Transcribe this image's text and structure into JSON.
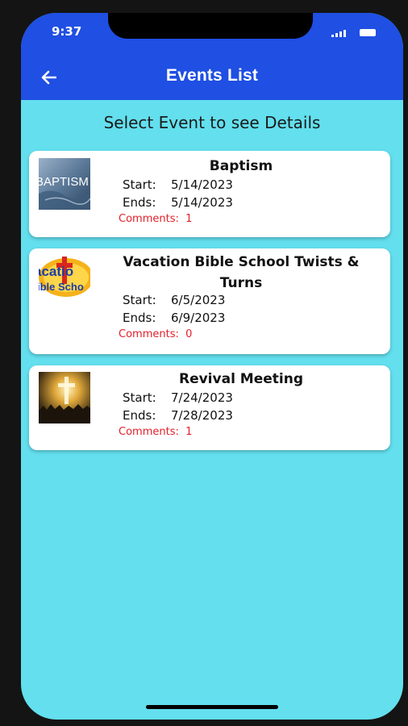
{
  "status_bar": {
    "time": "9:37"
  },
  "header": {
    "title": "Events List"
  },
  "subtitle": "Select Event to see Details",
  "events": [
    {
      "title": "Baptism",
      "start_label": "Start:",
      "start": "5/14/2023",
      "end_label": "Ends:",
      "end": "5/14/2023",
      "comments_label": "Comments:",
      "comments": "1",
      "thumb_text": "BAPTISM"
    },
    {
      "title": "Vacation Bible School Twists & Turns",
      "start_label": "Start:",
      "start": "6/5/2023",
      "end_label": "Ends:",
      "end": "6/9/2023",
      "comments_label": "Comments:",
      "comments": "0",
      "thumb_text": "acatio ible Scho"
    },
    {
      "title": "Revival Meeting",
      "start_label": "Start:",
      "start": "7/24/2023",
      "end_label": "Ends:",
      "end": "7/28/2023",
      "comments_label": "Comments:",
      "comments": "1"
    }
  ],
  "colors": {
    "header": "#1f4fe3",
    "background": "#63dfee",
    "comments": "#e3202a"
  }
}
